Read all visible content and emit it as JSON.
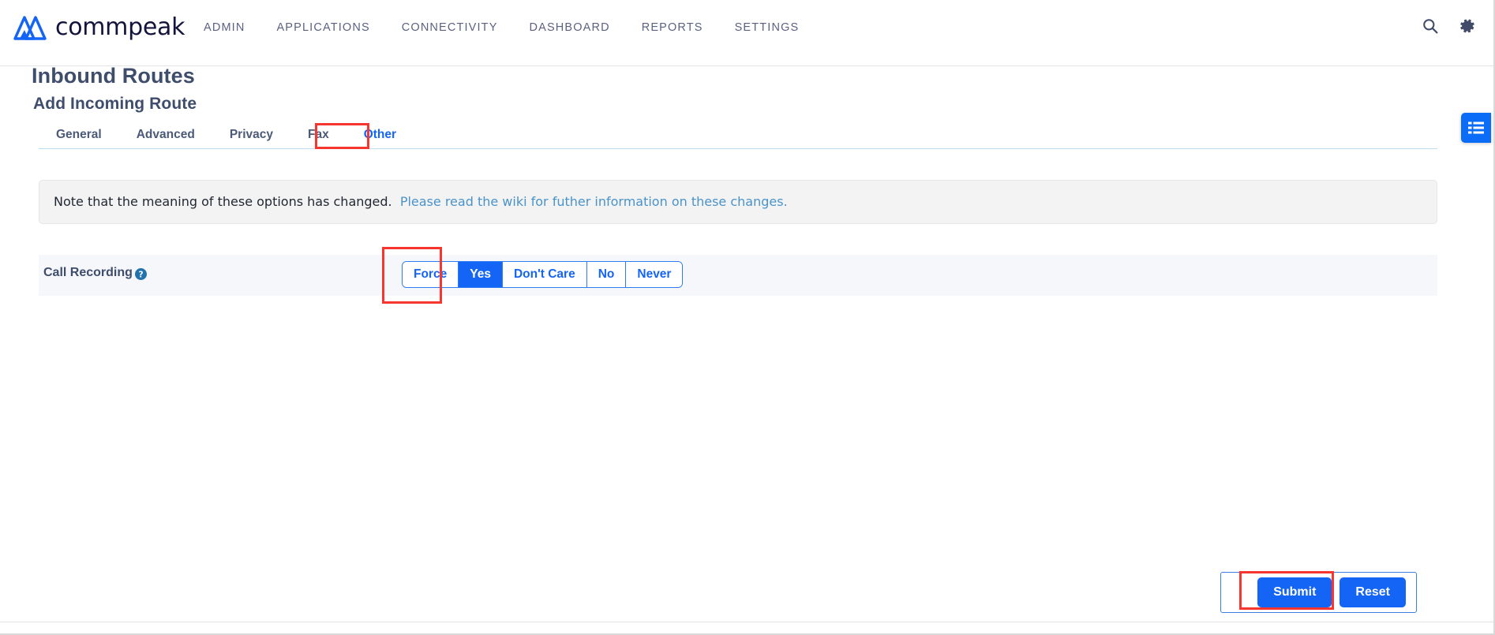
{
  "header": {
    "brand_name": "commpeak",
    "brand_logo_icon": "commpeak-triangles-logo",
    "nav": [
      {
        "label": "ADMIN"
      },
      {
        "label": "APPLICATIONS"
      },
      {
        "label": "CONNECTIVITY"
      },
      {
        "label": "DASHBOARD"
      },
      {
        "label": "REPORTS"
      },
      {
        "label": "SETTINGS"
      }
    ],
    "icons": [
      {
        "name": "search-icon"
      },
      {
        "name": "gear-icon"
      }
    ]
  },
  "page": {
    "title": "Inbound Routes",
    "subtitle": "Add Incoming Route"
  },
  "tabs": [
    {
      "label": "General",
      "active": false
    },
    {
      "label": "Advanced",
      "active": false
    },
    {
      "label": "Privacy",
      "active": false
    },
    {
      "label": "Fax",
      "active": false
    },
    {
      "label": "Other",
      "active": true
    }
  ],
  "notice": {
    "text": "Note that the meaning of these options has changed.",
    "link_text": "Please read the wiki for futher information on these changes."
  },
  "form": {
    "call_recording": {
      "label": "Call Recording",
      "help_icon": "question-circle-icon",
      "options": [
        {
          "label": "Force",
          "selected": false
        },
        {
          "label": "Yes",
          "selected": true
        },
        {
          "label": "Don't Care",
          "selected": false
        },
        {
          "label": "No",
          "selected": false
        },
        {
          "label": "Never",
          "selected": false
        }
      ],
      "selected_value": "Yes"
    }
  },
  "actions": {
    "submit_label": "Submit",
    "reset_label": "Reset"
  },
  "side_widget": {
    "icon": "list-panel-icon"
  },
  "colors": {
    "accent_blue": "#1464f6",
    "heading_slate": "#3e4d6b",
    "nav_slate": "#5a6282",
    "annotation_red": "#f7362f",
    "notice_bg": "#f3f3f4",
    "row_bg": "#f6f7fa",
    "link_blue": "#4a93c9"
  },
  "annotations": [
    {
      "name": "other-tab-highlight"
    },
    {
      "name": "yes-option-highlight"
    },
    {
      "name": "submit-button-highlight"
    }
  ]
}
